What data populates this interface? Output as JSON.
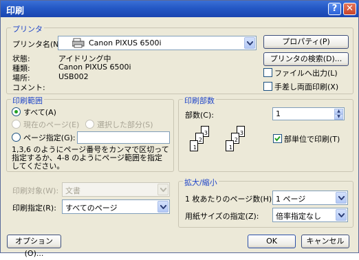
{
  "window": {
    "title": "印刷"
  },
  "printer": {
    "group_label": "プリンタ",
    "name_label": "プリンタ名(N):",
    "name_value": "Canon PIXUS 6500i",
    "properties_button": "プロパティ(P)",
    "search_button": "プリンタの検索(D)...",
    "status_label": "状態:",
    "status_value": "アイドリング中",
    "type_label": "種類:",
    "type_value": "Canon PIXUS 6500i",
    "location_label": "場所:",
    "location_value": "USB002",
    "comment_label": "コメント:",
    "print_to_file": "ファイルへ出力(L)",
    "manual_duplex": "手差し両面印刷(X)"
  },
  "range": {
    "group_label": "印刷範囲",
    "all": "すべて(A)",
    "current_page": "現在のページ(E)",
    "selection": "選択した部分(S)",
    "pages": "ページ指定(G):",
    "pages_value": "",
    "hint": "1,3,6 のようにページ番号をカンマで区切って指定するか、4-8 のようにページ範囲を指定してください。"
  },
  "copies": {
    "group_label": "印刷部数",
    "count_label": "部数(C):",
    "count_value": "1",
    "collate": "部単位で印刷(T)"
  },
  "print_what": {
    "label": "印刷対象(W):",
    "value": "文書"
  },
  "print_scope": {
    "label": "印刷指定(R):",
    "value": "すべてのページ"
  },
  "zoom": {
    "group_label": "拡大/縮小",
    "pages_per_sheet_label": "1 枚あたりのページ数(H):",
    "pages_per_sheet_value": "1 ページ",
    "scale_label": "用紙サイズの指定(Z):",
    "scale_value": "倍率指定なし"
  },
  "buttons": {
    "options": "オプション(O)...",
    "ok": "OK",
    "cancel": "キャンセル"
  }
}
